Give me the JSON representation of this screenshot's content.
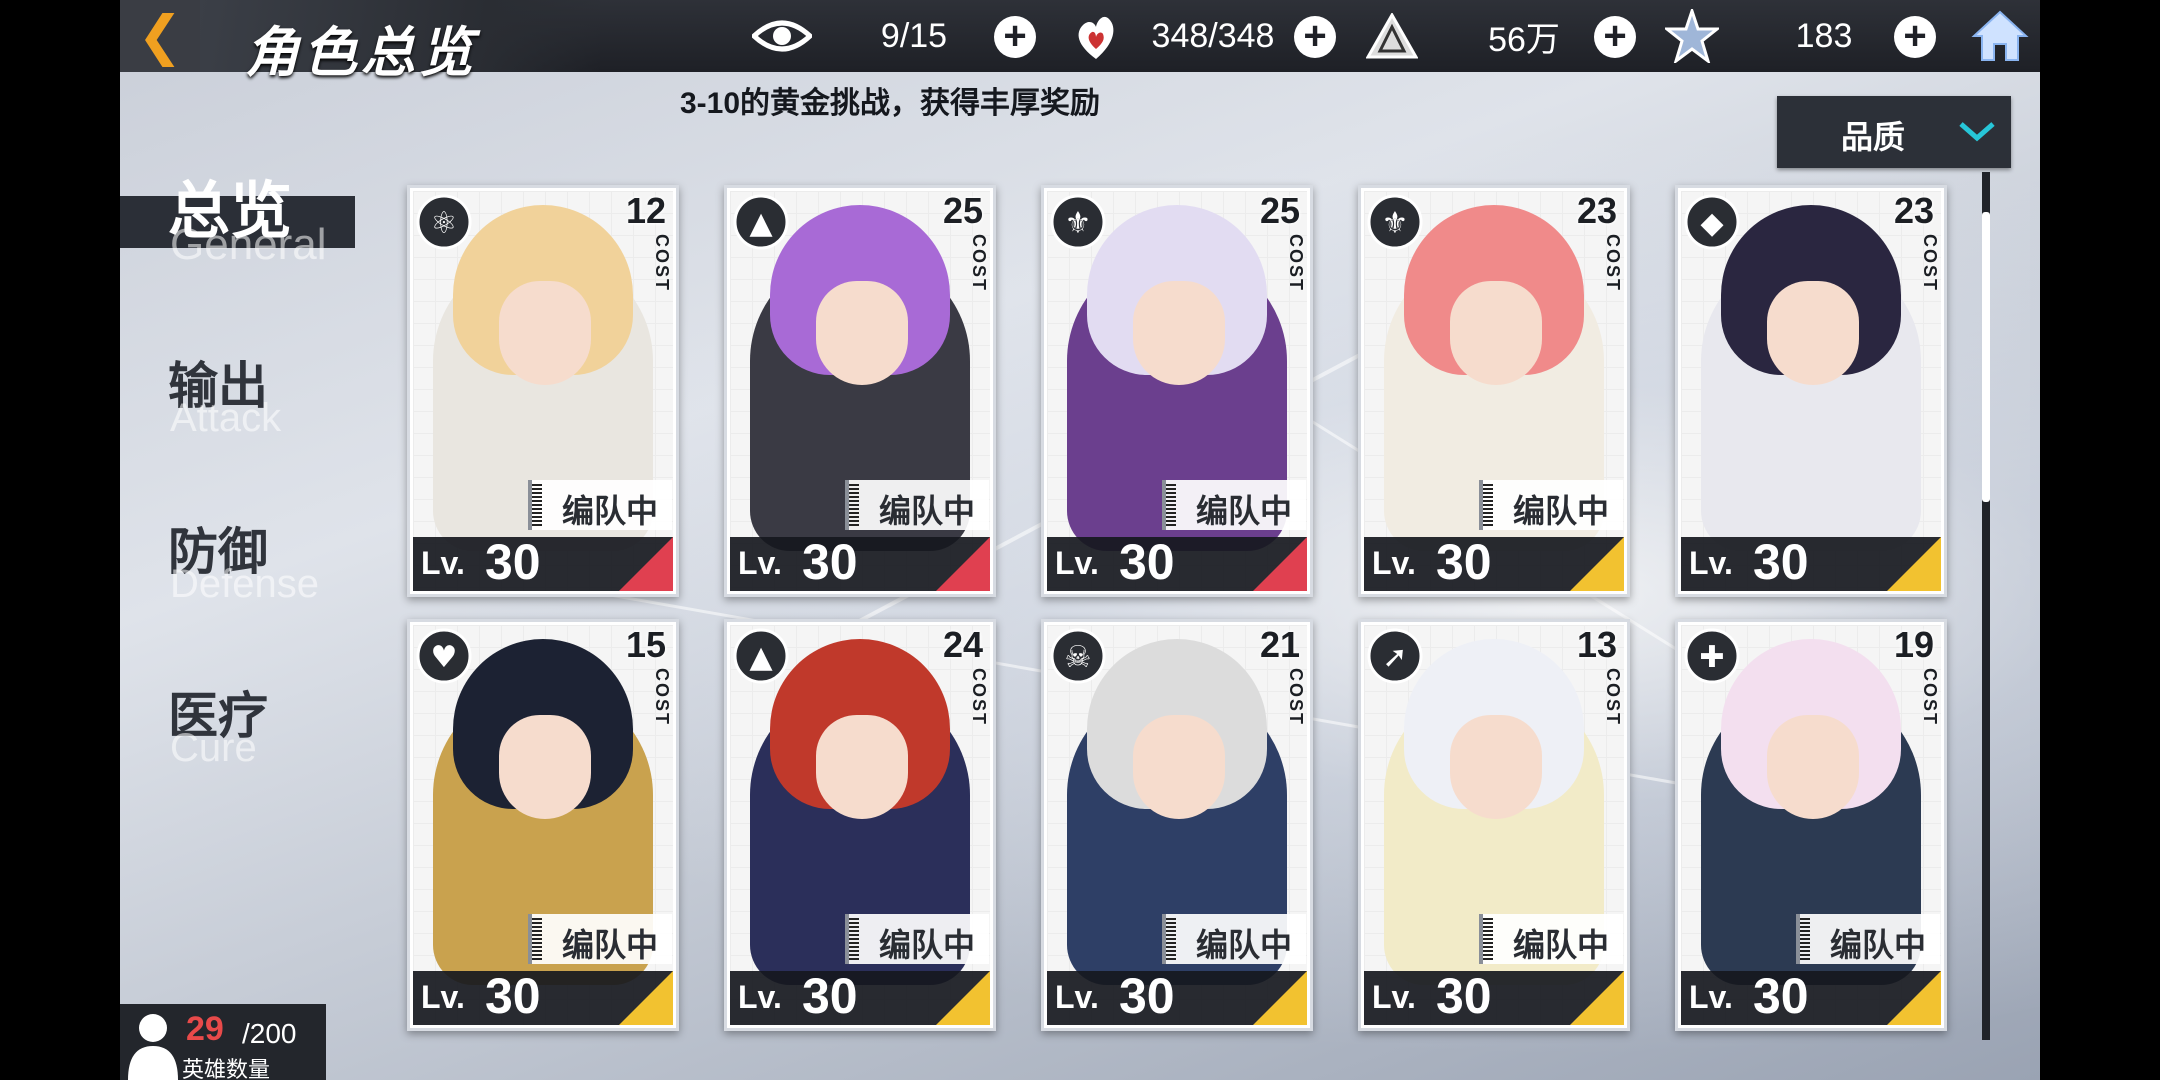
{
  "header": {
    "title": "角色总览",
    "stats": [
      {
        "icon": "eye-icon",
        "value": "9/15"
      },
      {
        "icon": "heart-flame-icon",
        "value": "348/348"
      },
      {
        "icon": "gold-pyramid-icon",
        "value": "56万"
      },
      {
        "icon": "crystal-star-icon",
        "value": "183"
      }
    ]
  },
  "marquee": "3-10的黄金挑战，获得丰厚奖励",
  "sort": {
    "label": "品质"
  },
  "nav": [
    {
      "cn": "总览",
      "en": "General",
      "active": true
    },
    {
      "cn": "输出",
      "en": "Attack",
      "active": false
    },
    {
      "cn": "防御",
      "en": "Defense",
      "active": false
    },
    {
      "cn": "医疗",
      "en": "Cure",
      "active": false
    }
  ],
  "cards": [
    {
      "class_icon": "dragon-icon",
      "cost": "12",
      "cost_label": "COST",
      "badge": "编队中",
      "lv_prefix": "Lv.",
      "level": "30",
      "rarity_color": "#e04050"
    },
    {
      "class_icon": "pistol-icon",
      "cost": "25",
      "cost_label": "COST",
      "badge": "编队中",
      "lv_prefix": "Lv.",
      "level": "30",
      "rarity_color": "#e04050"
    },
    {
      "class_icon": "winged-crest-icon",
      "cost": "25",
      "cost_label": "COST",
      "badge": "编队中",
      "lv_prefix": "Lv.",
      "level": "30",
      "rarity_color": "#e04050"
    },
    {
      "class_icon": "winged-crest-icon",
      "cost": "23",
      "cost_label": "COST",
      "badge": "编队中",
      "lv_prefix": "Lv.",
      "level": "30",
      "rarity_color": "#f2c230"
    },
    {
      "class_icon": "fox-mask-icon",
      "cost": "23",
      "cost_label": "COST",
      "badge": "",
      "lv_prefix": "Lv.",
      "level": "30",
      "rarity_color": "#f2c230"
    },
    {
      "class_icon": "winged-heart-icon",
      "cost": "15",
      "cost_label": "COST",
      "badge": "编队中",
      "lv_prefix": "Lv.",
      "level": "30",
      "rarity_color": "#f2c230"
    },
    {
      "class_icon": "pistol-icon",
      "cost": "24",
      "cost_label": "COST",
      "badge": "编队中",
      "lv_prefix": "Lv.",
      "level": "30",
      "rarity_color": "#f2c230"
    },
    {
      "class_icon": "horned-skull-icon",
      "cost": "21",
      "cost_label": "COST",
      "badge": "编队中",
      "lv_prefix": "Lv.",
      "level": "30",
      "rarity_color": "#f2c230"
    },
    {
      "class_icon": "bow-icon",
      "cost": "13",
      "cost_label": "COST",
      "badge": "编队中",
      "lv_prefix": "Lv.",
      "level": "30",
      "rarity_color": "#f2c230"
    },
    {
      "class_icon": "shield-cross-icon",
      "cost": "19",
      "cost_label": "COST",
      "badge": "编队中",
      "lv_prefix": "Lv.",
      "level": "30",
      "rarity_color": "#f2c230"
    }
  ],
  "hero_count": {
    "current": "29",
    "max": "/200",
    "label": "英雄数量"
  },
  "colors": {
    "accent": "#f0a020",
    "panel": "#2c3038",
    "count_red": "#e84a4a"
  }
}
